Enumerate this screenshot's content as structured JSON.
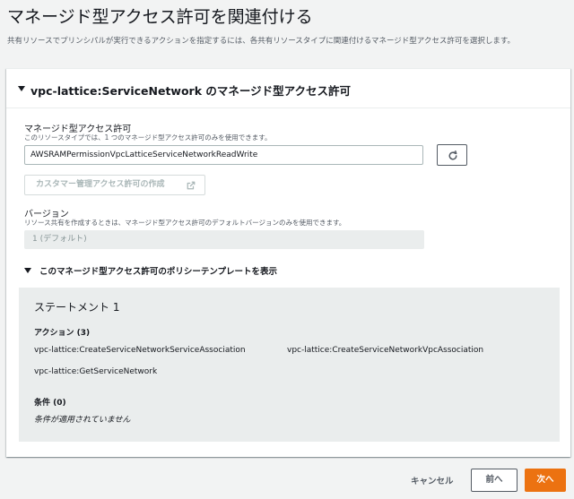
{
  "page": {
    "title": "マネージド型アクセス許可を関連付ける",
    "description": "共有リソースでプリンシパルが実行できるアクションを指定するには、各共有リソースタイプに関連付けるマネージド型アクセス許可を選択します。"
  },
  "panel": {
    "title": "vpc-lattice:ServiceNetwork のマネージド型アクセス許可",
    "permission": {
      "label": "マネージド型アクセス許可",
      "description": "このリソースタイプでは、1 つのマネージド型アクセス許可のみを使用できます。",
      "selected_value": "AWSRAMPermissionVpcLatticeServiceNetworkReadWrite",
      "refresh_icon": "refresh-icon"
    },
    "create_button": {
      "label": "カスタマー管理アクセス許可の作成",
      "icon": "external-link-icon"
    },
    "version": {
      "label": "バージョン",
      "description": "リソース共有を作成するときは、マネージド型アクセス許可のデフォルトバージョンのみを使用できます。",
      "value": "1 (デフォルト)"
    },
    "policy_template": {
      "toggle_label": "このマネージド型アクセス許可のポリシーテンプレートを表示",
      "statement_title": "ステートメント 1",
      "actions_heading": "アクション (3)",
      "actions": [
        "vpc-lattice:CreateServiceNetworkServiceAssociation",
        "vpc-lattice:CreateServiceNetworkVpcAssociation",
        "vpc-lattice:GetServiceNetwork"
      ],
      "conditions_heading": "条件 (0)",
      "conditions_empty": "条件が適用されていません"
    }
  },
  "footer": {
    "cancel_label": "キャンセル",
    "previous_label": "前へ",
    "next_label": "次へ"
  },
  "colors": {
    "primary": "#ec7211",
    "background": "#f2f3f3",
    "text": "#16191f",
    "muted_text": "#545b64"
  }
}
